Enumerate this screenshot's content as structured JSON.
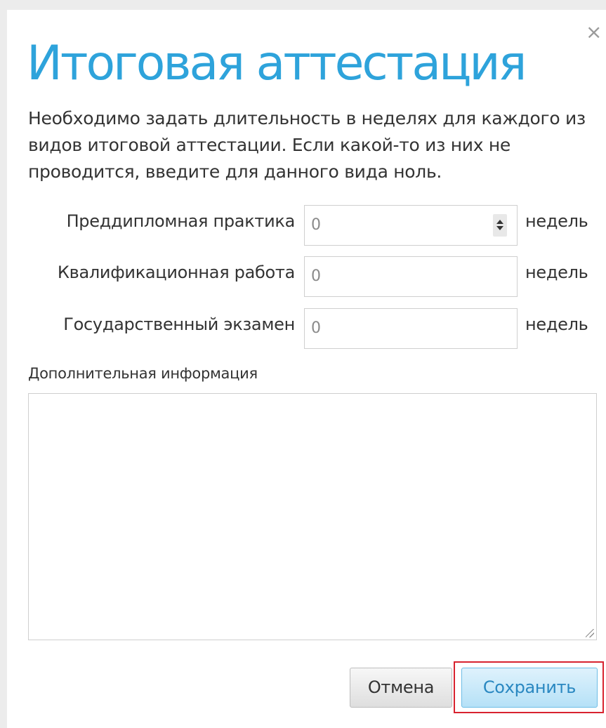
{
  "dialog": {
    "title": "Итоговая аттестация",
    "close_label": "×",
    "description": "Необходимо задать длительность в неделях для каждого из видов итоговой аттестации. Если какой-то из них не проводится, введите для данного вида ноль."
  },
  "fields": [
    {
      "label": "Преддипломная практика",
      "value": "0",
      "unit": "недель"
    },
    {
      "label": "Квалификационная работа",
      "value": "0",
      "unit": "недель"
    },
    {
      "label": "Государственный экзамен",
      "value": "0",
      "unit": "недель"
    }
  ],
  "extra": {
    "label": "Дополнительная информация",
    "value": ""
  },
  "buttons": {
    "cancel_label": "Отмена",
    "save_label": "Сохранить"
  },
  "colors": {
    "title": "#2ea3db",
    "highlight": "#d8232f"
  }
}
